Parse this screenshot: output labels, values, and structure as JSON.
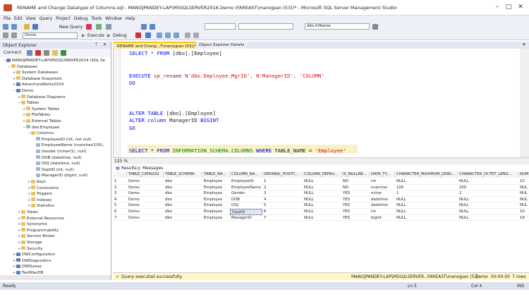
{
  "window": {
    "title": "RENAME and Change Datatype of Columns.sql - MANOJPANDEY-LAP\\MSSQLSERVER2016.Demo (FAREAST\\manojpan (53))* - Microsoft SQL Server Management Studio"
  },
  "menu": [
    "File",
    "Edit",
    "View",
    "Query",
    "Project",
    "Debug",
    "Tools",
    "Window",
    "Help"
  ],
  "toolbar": {
    "new_query": "New Query",
    "database": "Demo",
    "execute": "Execute",
    "debug": "Debug",
    "combo_right": "dbo.fnName"
  },
  "object_explorer": {
    "title": "Object Explorer",
    "connect": "Connect",
    "tree": [
      {
        "t": "MANOJPANDEY-LAP\\MSSQLSERVER2014 (SQL Se",
        "lvl": 0,
        "ex": "−",
        "ic": "srv"
      },
      {
        "t": "Databases",
        "lvl": 1,
        "ex": "−",
        "ic": "fld"
      },
      {
        "t": "System Databases",
        "lvl": 2,
        "ex": "+",
        "ic": "fld"
      },
      {
        "t": "Database Snapshots",
        "lvl": 2,
        "ex": "+",
        "ic": "fld"
      },
      {
        "t": "AdventureWorks2014",
        "lvl": 2,
        "ex": "+",
        "ic": "srv"
      },
      {
        "t": "Demo",
        "lvl": 2,
        "ex": "−",
        "ic": "srv"
      },
      {
        "t": "Database Diagrams",
        "lvl": 3,
        "ex": "+",
        "ic": "fld"
      },
      {
        "t": "Tables",
        "lvl": 3,
        "ex": "−",
        "ic": "fld"
      },
      {
        "t": "System Tables",
        "lvl": 4,
        "ex": "+",
        "ic": "fld"
      },
      {
        "t": "FileTables",
        "lvl": 4,
        "ex": "+",
        "ic": "fld"
      },
      {
        "t": "External Tables",
        "lvl": 4,
        "ex": "+",
        "ic": "fld"
      },
      {
        "t": "dbo.Employee",
        "lvl": 4,
        "ex": "−",
        "ic": "col"
      },
      {
        "t": "Columns",
        "lvl": 5,
        "ex": "−",
        "ic": "fld"
      },
      {
        "t": "EmployeeID (int, not null)",
        "lvl": 6,
        "ex": "",
        "ic": "col"
      },
      {
        "t": "EmployeeName (nvarchar(100),",
        "lvl": 6,
        "ex": "",
        "ic": "col"
      },
      {
        "t": "Gender (nchar(1), null)",
        "lvl": 6,
        "ex": "",
        "ic": "col"
      },
      {
        "t": "DOB (datetime, null)",
        "lvl": 6,
        "ex": "",
        "ic": "col"
      },
      {
        "t": "DOJ (datetime, null)",
        "lvl": 6,
        "ex": "",
        "ic": "col"
      },
      {
        "t": "DeptID (int, null)",
        "lvl": 6,
        "ex": "",
        "ic": "col"
      },
      {
        "t": "ManagerID (bigint, null)",
        "lvl": 6,
        "ex": "",
        "ic": "col"
      },
      {
        "t": "Keys",
        "lvl": 5,
        "ex": "+",
        "ic": "fld"
      },
      {
        "t": "Constraints",
        "lvl": 5,
        "ex": "+",
        "ic": "fld"
      },
      {
        "t": "Triggers",
        "lvl": 5,
        "ex": "+",
        "ic": "fld"
      },
      {
        "t": "Indexes",
        "lvl": 5,
        "ex": "+",
        "ic": "fld"
      },
      {
        "t": "Statistics",
        "lvl": 5,
        "ex": "+",
        "ic": "fld"
      },
      {
        "t": "Views",
        "lvl": 3,
        "ex": "+",
        "ic": "fld"
      },
      {
        "t": "External Resources",
        "lvl": 3,
        "ex": "+",
        "ic": "fld"
      },
      {
        "t": "Synonyms",
        "lvl": 3,
        "ex": "+",
        "ic": "fld"
      },
      {
        "t": "Programmability",
        "lvl": 3,
        "ex": "+",
        "ic": "fld"
      },
      {
        "t": "Service Broker",
        "lvl": 3,
        "ex": "+",
        "ic": "fld"
      },
      {
        "t": "Storage",
        "lvl": 3,
        "ex": "+",
        "ic": "fld"
      },
      {
        "t": "Security",
        "lvl": 3,
        "ex": "+",
        "ic": "fld"
      },
      {
        "t": "DWConfiguration",
        "lvl": 2,
        "ex": "+",
        "ic": "srv"
      },
      {
        "t": "DWDiagnostics",
        "lvl": 2,
        "ex": "+",
        "ic": "srv"
      },
      {
        "t": "DWQueue",
        "lvl": 2,
        "ex": "+",
        "ic": "srv"
      },
      {
        "t": "TestManDB",
        "lvl": 2,
        "ex": "+",
        "ic": "srv"
      }
    ]
  },
  "tabs": [
    {
      "label": "RENAME and Chang...T\\manojpan (53))*",
      "active": true
    },
    {
      "label": "Object Explorer Details",
      "active": false
    }
  ],
  "editor": {
    "lines": [
      [
        [
          "SELECT * FROM ",
          "kw"
        ],
        [
          "[dbo].[Employee]",
          ""
        ]
      ],
      [],
      [],
      [
        [
          "EXECUTE ",
          "kw"
        ],
        [
          "sp_rename ",
          "fn"
        ],
        [
          "N'dbo.Employee.MgrID', N'ManagerID', 'COLUMN'",
          "str"
        ]
      ],
      [
        [
          "GO",
          "kw"
        ]
      ],
      [],
      [],
      [],
      [
        [
          "ALTER TABLE ",
          "kw"
        ],
        [
          "[dbo].[Employee]",
          ""
        ]
      ],
      [
        [
          "ALTER column ",
          "kw"
        ],
        [
          "ManagerID ",
          ""
        ],
        [
          "BIGINT",
          "kw"
        ]
      ],
      [
        [
          "GO",
          "kw"
        ]
      ],
      [],
      [],
      [
        [
          "SELECT * FROM ",
          "kw"
        ],
        [
          "INFORMATION_SCHEMA.COLUMNS ",
          "sys"
        ],
        [
          "WHERE ",
          "kw"
        ],
        [
          "TABLE_NAME = ",
          ""
        ],
        [
          "'Employee'",
          "str"
        ]
      ]
    ]
  },
  "zoom": "125 %",
  "results": {
    "tabs": [
      "Results",
      "Messages"
    ],
    "headers": [
      "TABLE_CATALOG",
      "TABLE_SCHEMA",
      "TABLE_NA...",
      "COLUMN_NA...",
      "ORDINAL_POSITI...",
      "COLUMN_DEFAU...",
      "IS_NULLAB...",
      "DATA_TY...",
      "CHARACTER_MAXIMUM_LENG...",
      "CHARACTER_OCTET_LENG...",
      "NUM"
    ],
    "rows": [
      [
        "1",
        "Demo",
        "dbo",
        "Employee",
        "EmployeeID",
        "1",
        "NULL",
        "NO",
        "int",
        "NULL",
        "NULL",
        "10"
      ],
      [
        "2",
        "Demo",
        "dbo",
        "Employee",
        "EmployeeName",
        "2",
        "NULL",
        "NO",
        "nvarchar",
        "100",
        "200",
        "NUL"
      ],
      [
        "3",
        "Demo",
        "dbo",
        "Employee",
        "Gender",
        "3",
        "NULL",
        "YES",
        "nchar",
        "1",
        "2",
        "NUL"
      ],
      [
        "4",
        "Demo",
        "dbo",
        "Employee",
        "DOB",
        "4",
        "NULL",
        "YES",
        "datetime",
        "NULL",
        "NULL",
        "NUL"
      ],
      [
        "5",
        "Demo",
        "dbo",
        "Employee",
        "DOJ",
        "5",
        "NULL",
        "YES",
        "datetime",
        "NULL",
        "NULL",
        "NUL"
      ],
      [
        "6",
        "Demo",
        "dbo",
        "Employee",
        "DeptID",
        "6",
        "NULL",
        "YES",
        "int",
        "NULL",
        "NULL",
        "10"
      ],
      [
        "7",
        "Demo",
        "dbo",
        "Employee",
        "ManagerID",
        "7",
        "NULL",
        "YES",
        "bigint",
        "NULL",
        "NULL",
        "19"
      ]
    ]
  },
  "query_status": {
    "message": "Query executed successfully.",
    "server": "MANOJPANDEY-LAP\\MSSQLSERVER...",
    "user": "FAREAST\\manojpan (53)",
    "db": "Demo",
    "time": "00:00:00",
    "rows": "7 rows"
  },
  "statusbar": {
    "ready": "Ready",
    "ln": "Ln 5",
    "col": "Col 4",
    "ins": "INS"
  },
  "colors": {
    "accent": "#007acc",
    "query_ok": "#fff7c4",
    "selected_cell": "#dce8f8"
  }
}
